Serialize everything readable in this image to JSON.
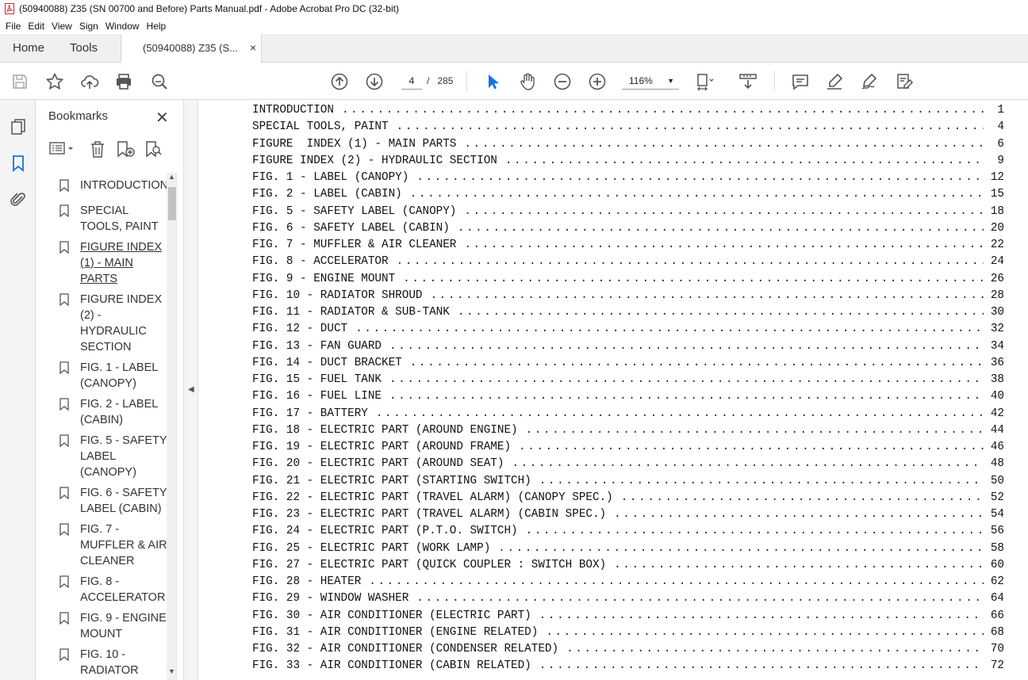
{
  "window": {
    "title": "(50940088) Z35 (SN 00700 and Before) Parts Manual.pdf - Adobe Acrobat Pro DC (32-bit)"
  },
  "menu": [
    "File",
    "Edit",
    "View",
    "Sign",
    "Window",
    "Help"
  ],
  "tabs": {
    "home": "Home",
    "tools": "Tools",
    "doc": "(50940088) Z35 (S...",
    "close": "×"
  },
  "toolbar": {
    "page_current": "4",
    "page_sep": "/",
    "page_total": "285",
    "zoom": "116%"
  },
  "bookmarks": {
    "header": "Bookmarks",
    "close": "✕",
    "items": [
      {
        "label": "INTRODUCTION"
      },
      {
        "label": "SPECIAL TOOLS, PAINT"
      },
      {
        "label": "FIGURE INDEX (1) - MAIN PARTS"
      },
      {
        "label": "FIGURE INDEX (2) - HYDRAULIC SECTION"
      },
      {
        "label": "FIG. 1 - LABEL (CANOPY)"
      },
      {
        "label": "FIG. 2 - LABEL (CABIN)"
      },
      {
        "label": "FIG. 5 - SAFETY LABEL (CANOPY)"
      },
      {
        "label": "FIG. 6 - SAFETY LABEL (CABIN)"
      },
      {
        "label": "FIG. 7 - MUFFLER & AIR CLEANER"
      },
      {
        "label": "FIG. 8 - ACCELERATOR"
      },
      {
        "label": "FIG. 9 - ENGINE MOUNT"
      },
      {
        "label": "FIG. 10 - RADIATOR"
      }
    ]
  },
  "toc": [
    {
      "title": "INTRODUCTION",
      "page": "1"
    },
    {
      "title": "SPECIAL TOOLS, PAINT",
      "page": "4"
    },
    {
      "title": "FIGURE  INDEX (1) - MAIN PARTS",
      "page": "6"
    },
    {
      "title": "FIGURE INDEX (2) - HYDRAULIC SECTION",
      "page": "9"
    },
    {
      "title": "FIG. 1 - LABEL (CANOPY)",
      "page": "12"
    },
    {
      "title": "FIG. 2 - LABEL (CABIN)",
      "page": "15"
    },
    {
      "title": "FIG. 5 - SAFETY LABEL (CANOPY)",
      "page": "18"
    },
    {
      "title": "FIG. 6 - SAFETY LABEL (CABIN)",
      "page": "20"
    },
    {
      "title": "FIG. 7 - MUFFLER & AIR CLEANER",
      "page": "22"
    },
    {
      "title": "FIG. 8 - ACCELERATOR",
      "page": "24"
    },
    {
      "title": "FIG. 9 - ENGINE MOUNT",
      "page": "26"
    },
    {
      "title": "FIG. 10 - RADIATOR SHROUD",
      "page": "28"
    },
    {
      "title": "FIG. 11 - RADIATOR & SUB-TANK",
      "page": "30"
    },
    {
      "title": "FIG. 12 - DUCT",
      "page": "32"
    },
    {
      "title": "FIG. 13 - FAN GUARD",
      "page": "34"
    },
    {
      "title": "FIG. 14 - DUCT BRACKET",
      "page": "36"
    },
    {
      "title": "FIG. 15 - FUEL TANK",
      "page": "38"
    },
    {
      "title": "FIG. 16 - FUEL LINE",
      "page": "40"
    },
    {
      "title": "FIG. 17 - BATTERY",
      "page": "42"
    },
    {
      "title": "FIG. 18 - ELECTRIC PART (AROUND ENGINE)",
      "page": "44"
    },
    {
      "title": "FIG. 19 - ELECTRIC PART (AROUND FRAME)",
      "page": "46"
    },
    {
      "title": "FIG. 20 - ELECTRIC PART (AROUND SEAT)",
      "page": "48"
    },
    {
      "title": "FIG. 21 - ELECTRIC PART (STARTING SWITCH)",
      "page": "50"
    },
    {
      "title": "FIG. 22 - ELECTRIC PART (TRAVEL ALARM) (CANOPY SPEC.)",
      "page": "52"
    },
    {
      "title": "FIG. 23 - ELECTRIC PART (TRAVEL ALARM) (CABIN SPEC.)",
      "page": "54"
    },
    {
      "title": "FIG. 24 - ELECTRIC PART (P.T.O. SWITCH)",
      "page": "56"
    },
    {
      "title": "FIG. 25 - ELECTRIC PART (WORK LAMP)",
      "page": "58"
    },
    {
      "title": "FIG. 27 - ELECTRIC PART (QUICK COUPLER : SWITCH BOX)",
      "page": "60"
    },
    {
      "title": "FIG. 28 - HEATER",
      "page": "62"
    },
    {
      "title": "FIG. 29 - WINDOW WASHER",
      "page": "64"
    },
    {
      "title": "FIG. 30 - AIR CONDITIONER (ELECTRIC PART)",
      "page": "66"
    },
    {
      "title": "FIG. 31 - AIR CONDITIONER (ENGINE RELATED)",
      "page": "68"
    },
    {
      "title": "FIG. 32 - AIR CONDITIONER (CONDENSER RELATED)",
      "page": "70"
    },
    {
      "title": "FIG. 33 - AIR CONDITIONER (CABIN RELATED)",
      "page": "72"
    }
  ],
  "colors": {
    "accent": "#1473e6",
    "pdf_red": "#d4242b",
    "tab_bg": "#f0f0f0"
  }
}
